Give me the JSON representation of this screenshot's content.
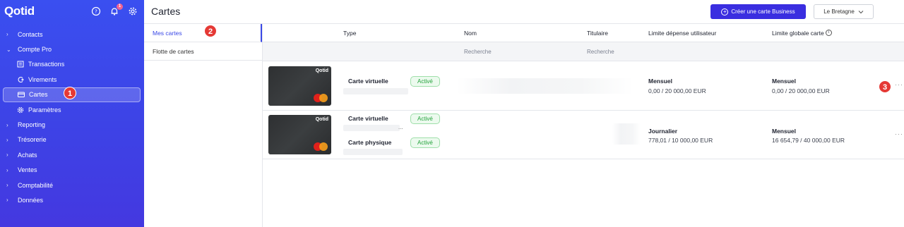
{
  "app": {
    "name": "Qotid",
    "notif_count": "1"
  },
  "sidebar": {
    "items": [
      {
        "label": "Contacts",
        "kind": "group"
      },
      {
        "label": "Compte Pro",
        "kind": "group-open"
      },
      {
        "label": "Transactions",
        "kind": "sub",
        "icon": "list-icon"
      },
      {
        "label": "Virements",
        "kind": "sub",
        "icon": "transfer-icon"
      },
      {
        "label": "Cartes",
        "kind": "sub",
        "icon": "card-icon",
        "active": true
      },
      {
        "label": "Paramètres",
        "kind": "sub",
        "icon": "gear-icon"
      },
      {
        "label": "Reporting",
        "kind": "group"
      },
      {
        "label": "Trésorerie",
        "kind": "group"
      },
      {
        "label": "Achats",
        "kind": "group"
      },
      {
        "label": "Ventes",
        "kind": "group"
      },
      {
        "label": "Comptabilité",
        "kind": "group"
      },
      {
        "label": "Données",
        "kind": "group"
      }
    ]
  },
  "header": {
    "title": "Cartes",
    "create_button": "Créer une carte Business",
    "entity_select": "Le Bretagne"
  },
  "submenu": {
    "items": [
      "Mes cartes",
      "Flotte de cartes"
    ]
  },
  "steps": [
    "1",
    "2",
    "3"
  ],
  "table": {
    "columns": [
      "Type",
      "Nom",
      "Titulaire",
      "Limite dépense utilisateur",
      "Limite globale carte"
    ],
    "filters": {
      "nom": "Recherche",
      "titulaire": "Recherche"
    },
    "card_brand": "Qotid",
    "rows": [
      {
        "cards": [
          {
            "type": "Carte virtuelle",
            "status": "Activé"
          }
        ],
        "user_limit": {
          "period": "Mensuel",
          "value": "0,00 / 20 000,00 EUR"
        },
        "global_limit": {
          "period": "Mensuel",
          "value": "0,00 / 20 000,00 EUR"
        },
        "more": "···"
      },
      {
        "cards": [
          {
            "type": "Carte virtuelle",
            "status": "Activé",
            "trail": "..."
          },
          {
            "type": "Carte physique",
            "status": "Activé"
          }
        ],
        "user_limit": {
          "period": "Journalier",
          "value": "778,01 / 10 000,00 EUR"
        },
        "global_limit": {
          "period": "Mensuel",
          "value": "16 654,79 / 40 000,00 EUR"
        },
        "more": "···"
      }
    ]
  },
  "colors": {
    "primary": "#3a2ee0",
    "sidebar": "#3d43e6",
    "active_badge": "#23a23b",
    "step": "#e53935"
  }
}
